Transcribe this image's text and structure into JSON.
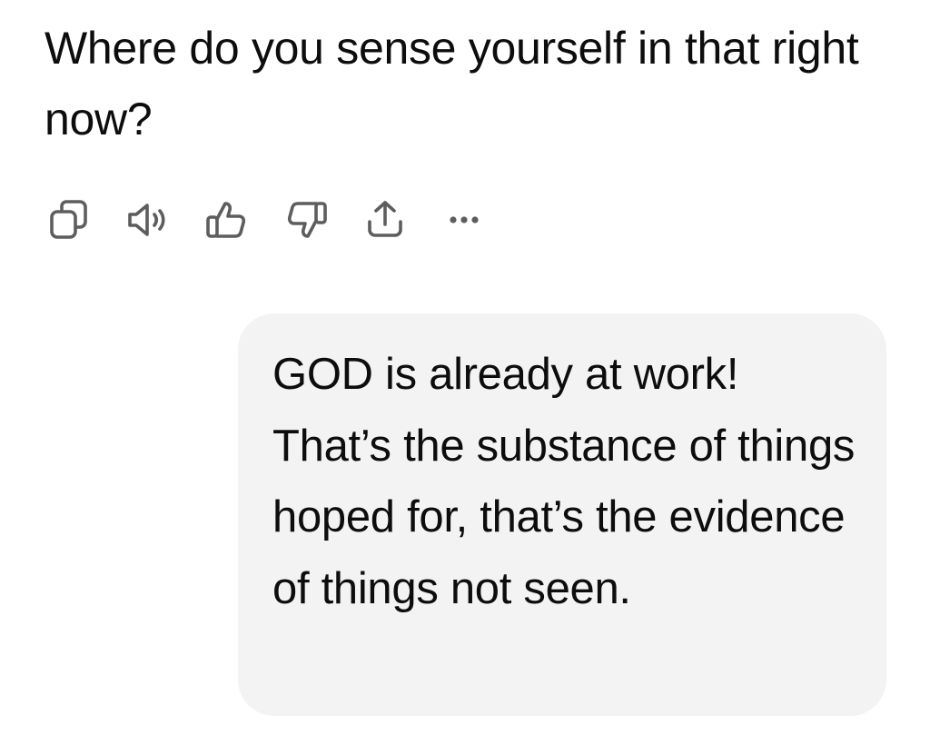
{
  "assistant": {
    "message": "Where do you sense yourself in that right now?"
  },
  "actions": [
    {
      "name": "copy",
      "icon": "copy-icon"
    },
    {
      "name": "read-aloud",
      "icon": "speaker-icon"
    },
    {
      "name": "good-response",
      "icon": "thumbs-up-icon"
    },
    {
      "name": "bad-response",
      "icon": "thumbs-down-icon"
    },
    {
      "name": "share",
      "icon": "share-icon"
    },
    {
      "name": "more",
      "icon": "more-horizontal-icon"
    }
  ],
  "user": {
    "message": "GOD is already at work! That’s the substance of things hoped for, that’s the evidence of things not seen."
  },
  "colors": {
    "text": "#0d0d0d",
    "bubble": "#f3f3f3",
    "icon": "#5d5d5d"
  }
}
